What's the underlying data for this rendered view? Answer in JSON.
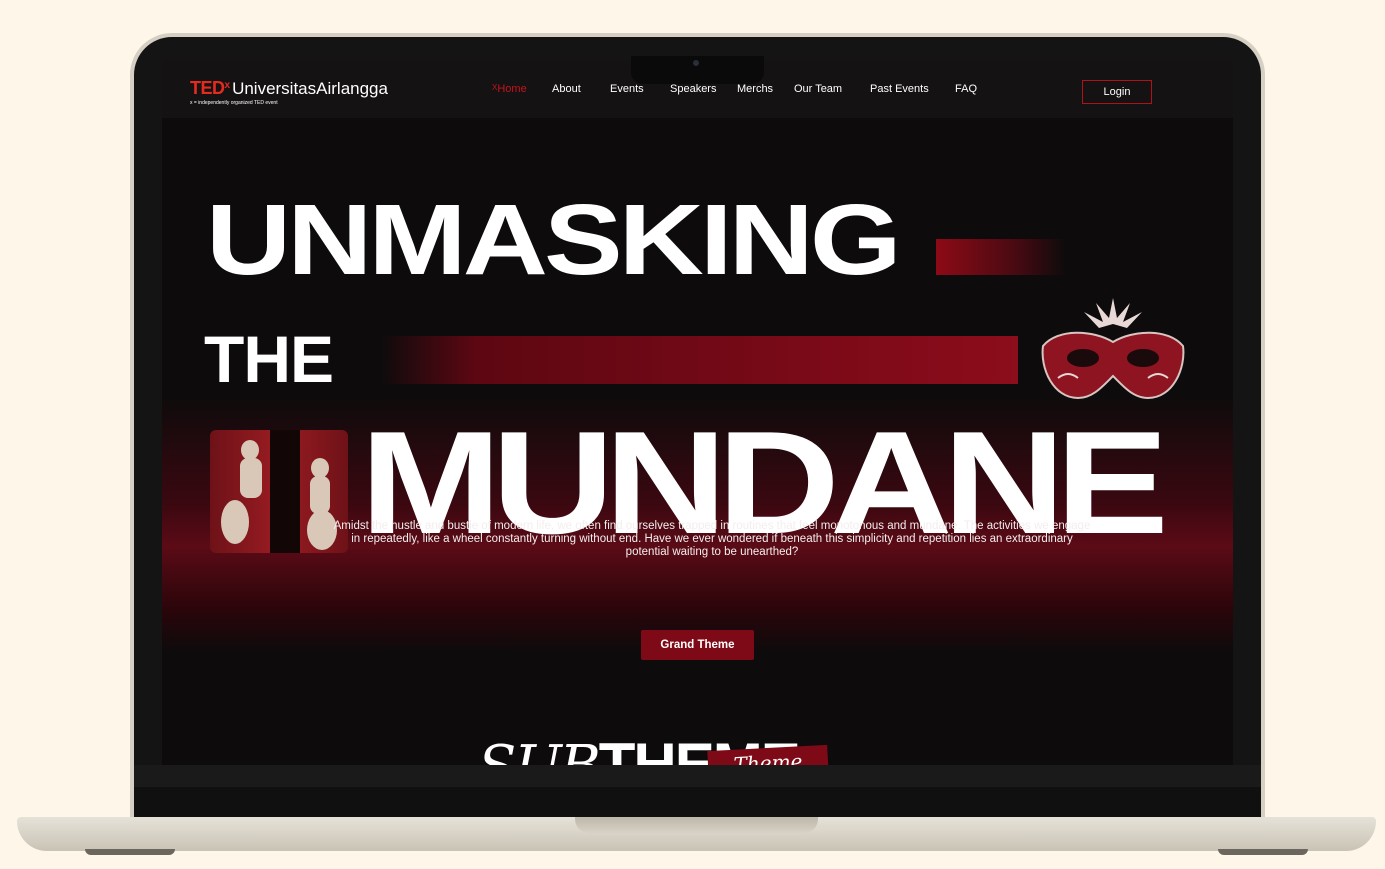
{
  "nav": {
    "logo_ted": "TED",
    "logo_x": "x",
    "logo_name": "UniversitasAirlangga",
    "logo_sub": "x = independently organized TED event",
    "items": [
      {
        "label": "Home",
        "active": true
      },
      {
        "label": "About"
      },
      {
        "label": "Events"
      },
      {
        "label": "Speakers"
      },
      {
        "label": "Merchs"
      },
      {
        "label": "Our Team"
      },
      {
        "label": "Past Events"
      },
      {
        "label": "FAQ"
      }
    ],
    "login_label": "Login",
    "active_marker": "X"
  },
  "hero": {
    "line1": "UNMASKING",
    "line2": "THE",
    "line3": "MUNDANE",
    "description": "Amidst the hustle and bustle of modern life, we often find ourselves trapped in routines that feel monotonous and mundane. The activities we engage in repeatedly, like a wheel constantly turning without end. Have we ever wondered if beneath this simplicity and repetition lies an extraordinary potential waiting to be unearthed?",
    "cta_label": "Grand Theme"
  },
  "subtheme": {
    "italic": "SUB",
    "bold": "THEME",
    "tag": "Theme"
  },
  "colors": {
    "accent": "#7e0a17",
    "brand_red": "#e62b1e",
    "background": "#0d0b0c",
    "page_bg": "#fdf6e9"
  }
}
